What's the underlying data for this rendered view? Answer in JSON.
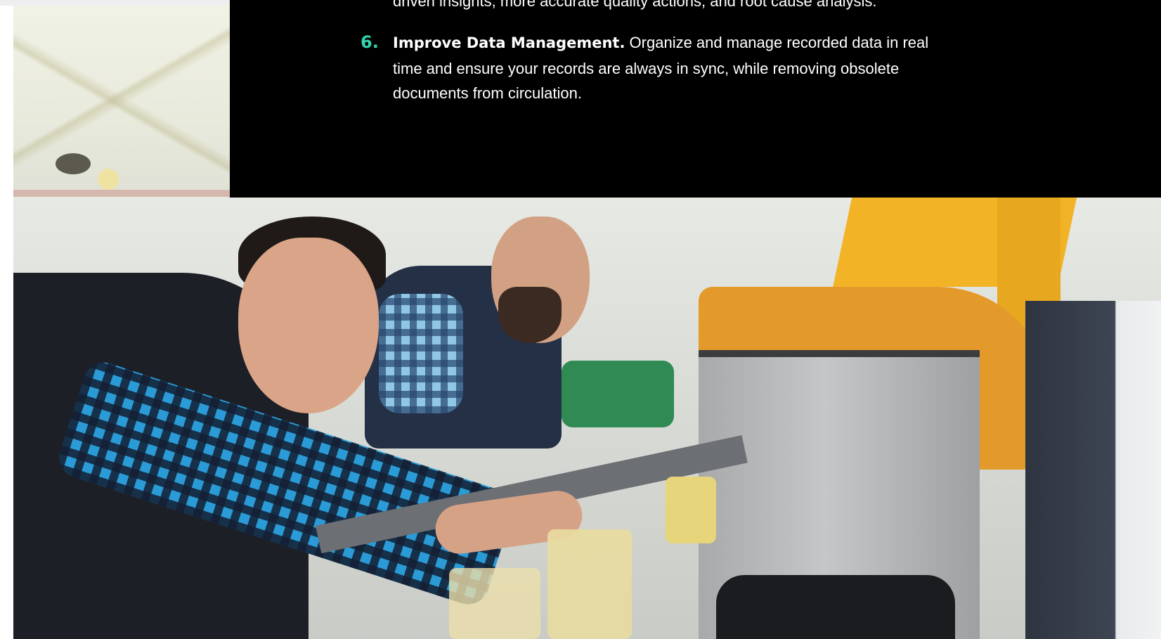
{
  "list": {
    "partial_previous_line": "driven insights, more accurate quality actions, and root cause analysis.",
    "item": {
      "number": "6.",
      "heading": "Improve Data Management.",
      "body": " Organize and manage recorded data in real time and ensure your records are always in sync, while removing obsolete documents from circulation."
    }
  },
  "colors": {
    "panel_background": "#000000",
    "number_accent": "#2fd6ad",
    "text": "#ffffff",
    "machine_accent": "#f2b327"
  },
  "images": {
    "hero_photo": "factory-workers-at-machine-photo"
  }
}
